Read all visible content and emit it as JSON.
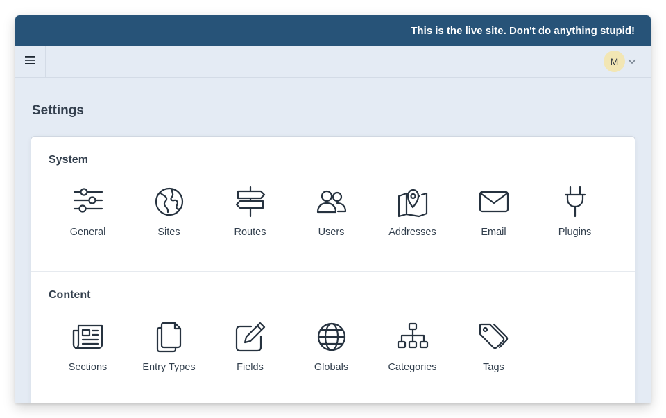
{
  "banner": {
    "message": "This is the live site. Don't do anything stupid!",
    "background": "#275378"
  },
  "topbar": {
    "menu_icon": "hamburger-icon",
    "user": {
      "initial": "M",
      "avatar_color": "#f2e6b4",
      "dropdown_icon": "chevron-down-icon"
    }
  },
  "page": {
    "title": "Settings"
  },
  "sections": [
    {
      "heading": "System",
      "items": [
        {
          "label": "General",
          "icon": "sliders-icon"
        },
        {
          "label": "Sites",
          "icon": "globe-americas-icon"
        },
        {
          "label": "Routes",
          "icon": "signpost-icon"
        },
        {
          "label": "Users",
          "icon": "users-icon"
        },
        {
          "label": "Addresses",
          "icon": "map-pin-icon"
        },
        {
          "label": "Email",
          "icon": "envelope-icon"
        },
        {
          "label": "Plugins",
          "icon": "plug-icon"
        }
      ]
    },
    {
      "heading": "Content",
      "items": [
        {
          "label": "Sections",
          "icon": "newspaper-icon"
        },
        {
          "label": "Entry Types",
          "icon": "copy-icon"
        },
        {
          "label": "Fields",
          "icon": "pen-square-icon"
        },
        {
          "label": "Globals",
          "icon": "globe-icon"
        },
        {
          "label": "Categories",
          "icon": "sitemap-icon"
        },
        {
          "label": "Tags",
          "icon": "tags-icon"
        }
      ]
    }
  ],
  "colors": {
    "page_background": "#e4ebf4",
    "text": "#333f4d",
    "icon": "#26323f"
  }
}
